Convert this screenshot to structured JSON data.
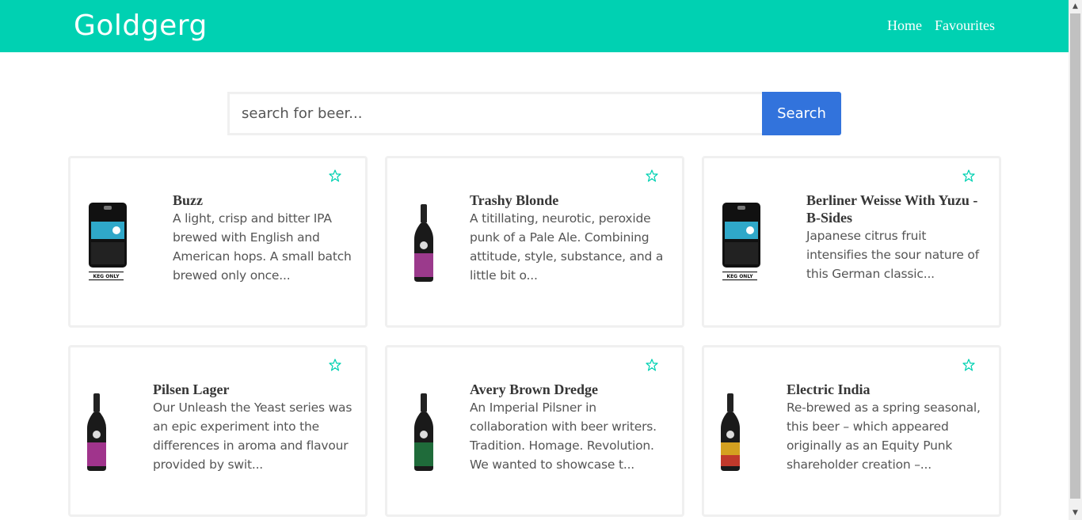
{
  "header": {
    "brand": "Goldgerg",
    "nav": [
      {
        "label": "Home"
      },
      {
        "label": "Favourites"
      }
    ],
    "color": "#00d1b2"
  },
  "search": {
    "placeholder": "search for beer...",
    "value": "",
    "button_label": "Search",
    "button_color": "#3273dc"
  },
  "beers": [
    {
      "name": "Buzz",
      "description": "A light, crisp and bitter IPA brewed with English and American hops. A small batch brewed only once...",
      "image": "keg",
      "keg_label": "KEG ONLY",
      "favourite_icon": "star-outline-icon"
    },
    {
      "name": "Trashy Blonde",
      "description": "A titillating, neurotic, peroxide punk of a Pale Ale. Combining attitude, style, substance, and a little bit o...",
      "image": "bottle",
      "label_color": "#9b3a8c",
      "favourite_icon": "star-outline-icon"
    },
    {
      "name": "Berliner Weisse With Yuzu - B-Sides",
      "description": "Japanese citrus fruit intensifies the sour nature of this German classic...",
      "image": "keg",
      "keg_label": "KEG ONLY",
      "favourite_icon": "star-outline-icon"
    },
    {
      "name": "Pilsen Lager",
      "description": "Our Unleash the Yeast series was an epic experiment into the differences in aroma and flavour provided by swit...",
      "image": "bottle",
      "label_color": "#a0348c",
      "favourite_icon": "star-outline-icon"
    },
    {
      "name": "Avery Brown Dredge",
      "description": "An Imperial Pilsner in collaboration with beer writers. Tradition. Homage. Revolution. We wanted to showcase t...",
      "image": "bottle",
      "label_color": "#1f6b3a",
      "favourite_icon": "star-outline-icon"
    },
    {
      "name": "Electric India",
      "description": "Re-brewed as a spring seasonal, this beer – which appeared originally as an Equity Punk shareholder creation –...",
      "image": "bottle",
      "label_color": "#d4a020",
      "favourite_icon": "star-outline-icon"
    }
  ]
}
